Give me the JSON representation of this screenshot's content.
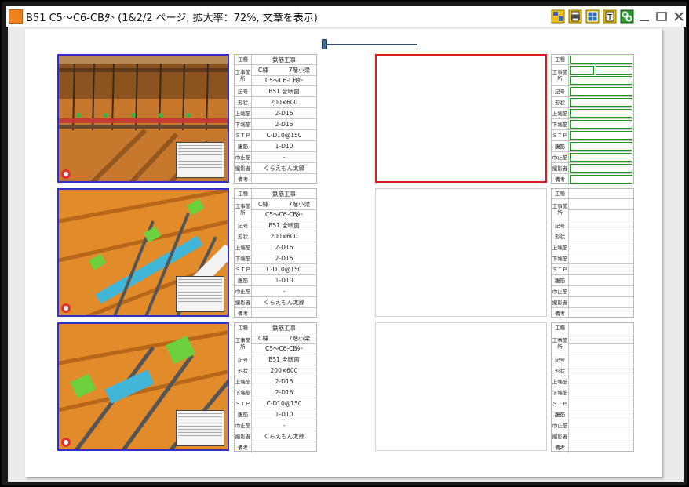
{
  "window": {
    "title": "B51 C5～C6-CB外 (1&2/2 ページ, 拡大率：72%, 文章を表示)",
    "accent": "#f0821e",
    "toolbar": [
      "layout-icon",
      "print-icon",
      "grid-icon",
      "text-icon",
      "settings-icon",
      "minimize-icon",
      "maximize-icon",
      "close-icon"
    ]
  },
  "labels": {
    "kousyu": "工種",
    "kouji_kasho": "工事箇所",
    "kigou": "記号",
    "keijou": "形状",
    "uwaba": "上端筋",
    "shitaba": "下端筋",
    "stp": "ＳＴＰ",
    "haraki": "腹筋",
    "habadome": "巾止筋",
    "satsueisha": "撮影者",
    "bikou": "備考"
  },
  "records": [
    {
      "kousyu": "鉄筋工事",
      "kasho_a": "C棟",
      "kasho_b": "7階小梁",
      "kasho_c": "C5～C6-CB外",
      "kigou": "B51 全断面",
      "keijou": "200×600",
      "uwaba": "2-D16",
      "shitaba": "2-D16",
      "stp": "C-D10@150",
      "haraki": "1-D10",
      "habadome": "-",
      "satsueisha": "くらえもん太郎",
      "bikou": ""
    },
    {
      "kousyu": "鉄筋工事",
      "kasho_a": "C棟",
      "kasho_b": "7階小梁",
      "kasho_c": "C5～C6-CB外",
      "kigou": "B51 全断面",
      "keijou": "200×600",
      "uwaba": "2-D16",
      "shitaba": "2-D16",
      "stp": "C-D10@150",
      "haraki": "1-D10",
      "habadome": "-",
      "satsueisha": "くらえもん太郎",
      "bikou": ""
    },
    {
      "kousyu": "鉄筋工事",
      "kasho_a": "C棟",
      "kasho_b": "7階小梁",
      "kasho_c": "C5～C6-CB外",
      "kigou": "B51 全断面",
      "keijou": "200×600",
      "uwaba": "2-D16",
      "shitaba": "2-D16",
      "stp": "C-D10@150",
      "haraki": "1-D10",
      "habadome": "-",
      "satsueisha": "くらえもん太郎",
      "bikou": ""
    }
  ]
}
